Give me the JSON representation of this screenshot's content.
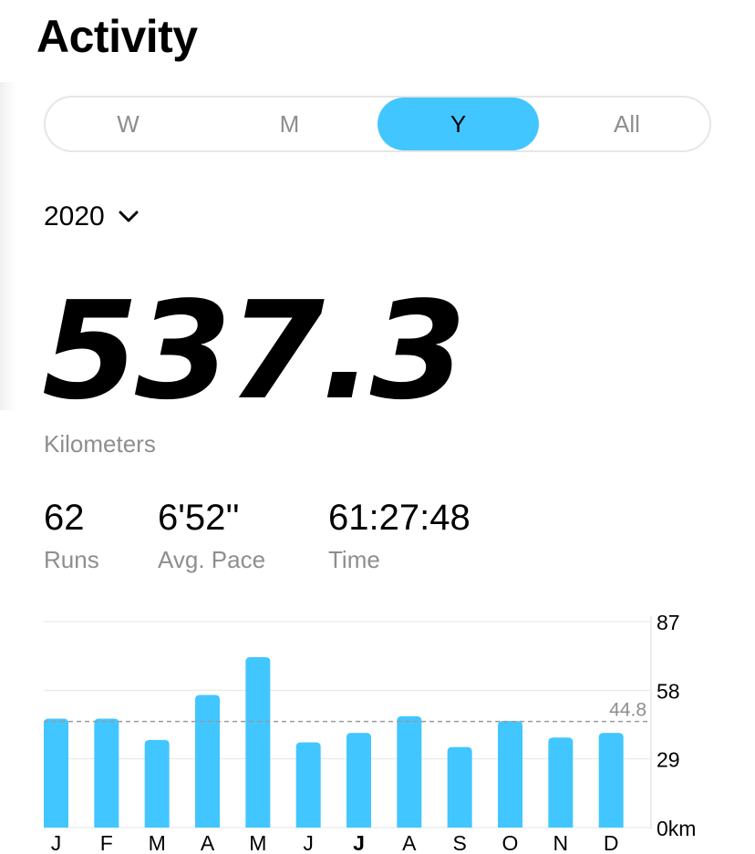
{
  "header": {
    "title": "Activity"
  },
  "period_tabs": [
    {
      "label": "W",
      "active": false
    },
    {
      "label": "M",
      "active": false
    },
    {
      "label": "Y",
      "active": true
    },
    {
      "label": "All",
      "active": false
    }
  ],
  "year_selector": {
    "value": "2020",
    "icon": "chevron-down-icon"
  },
  "summary": {
    "distance": "537.3",
    "distance_unit": "Kilometers"
  },
  "stats": [
    {
      "value": "62",
      "label": "Runs"
    },
    {
      "value": "6'52''",
      "label": "Avg. Pace"
    },
    {
      "value": "61:27:48",
      "label": "Time"
    }
  ],
  "colors": {
    "accent": "#42c6ff",
    "muted": "#8e8e8e",
    "gridline": "#e6e6e6"
  },
  "chart_data": {
    "type": "bar",
    "categories": [
      "J",
      "F",
      "M",
      "A",
      "M",
      "J",
      "J",
      "A",
      "S",
      "O",
      "N",
      "D"
    ],
    "highlighted_category_index": 6,
    "values": [
      46,
      46,
      37,
      56,
      72,
      36,
      40,
      47,
      34,
      45,
      38,
      40
    ],
    "ylim": [
      0,
      87
    ],
    "y_ticks": [
      {
        "value": 87,
        "label": "87"
      },
      {
        "value": 58,
        "label": "58"
      },
      {
        "value": 29,
        "label": "29"
      },
      {
        "value": 0,
        "label": "0km"
      }
    ],
    "average": {
      "value": 44.8,
      "label": "44.8"
    },
    "grid": true
  }
}
